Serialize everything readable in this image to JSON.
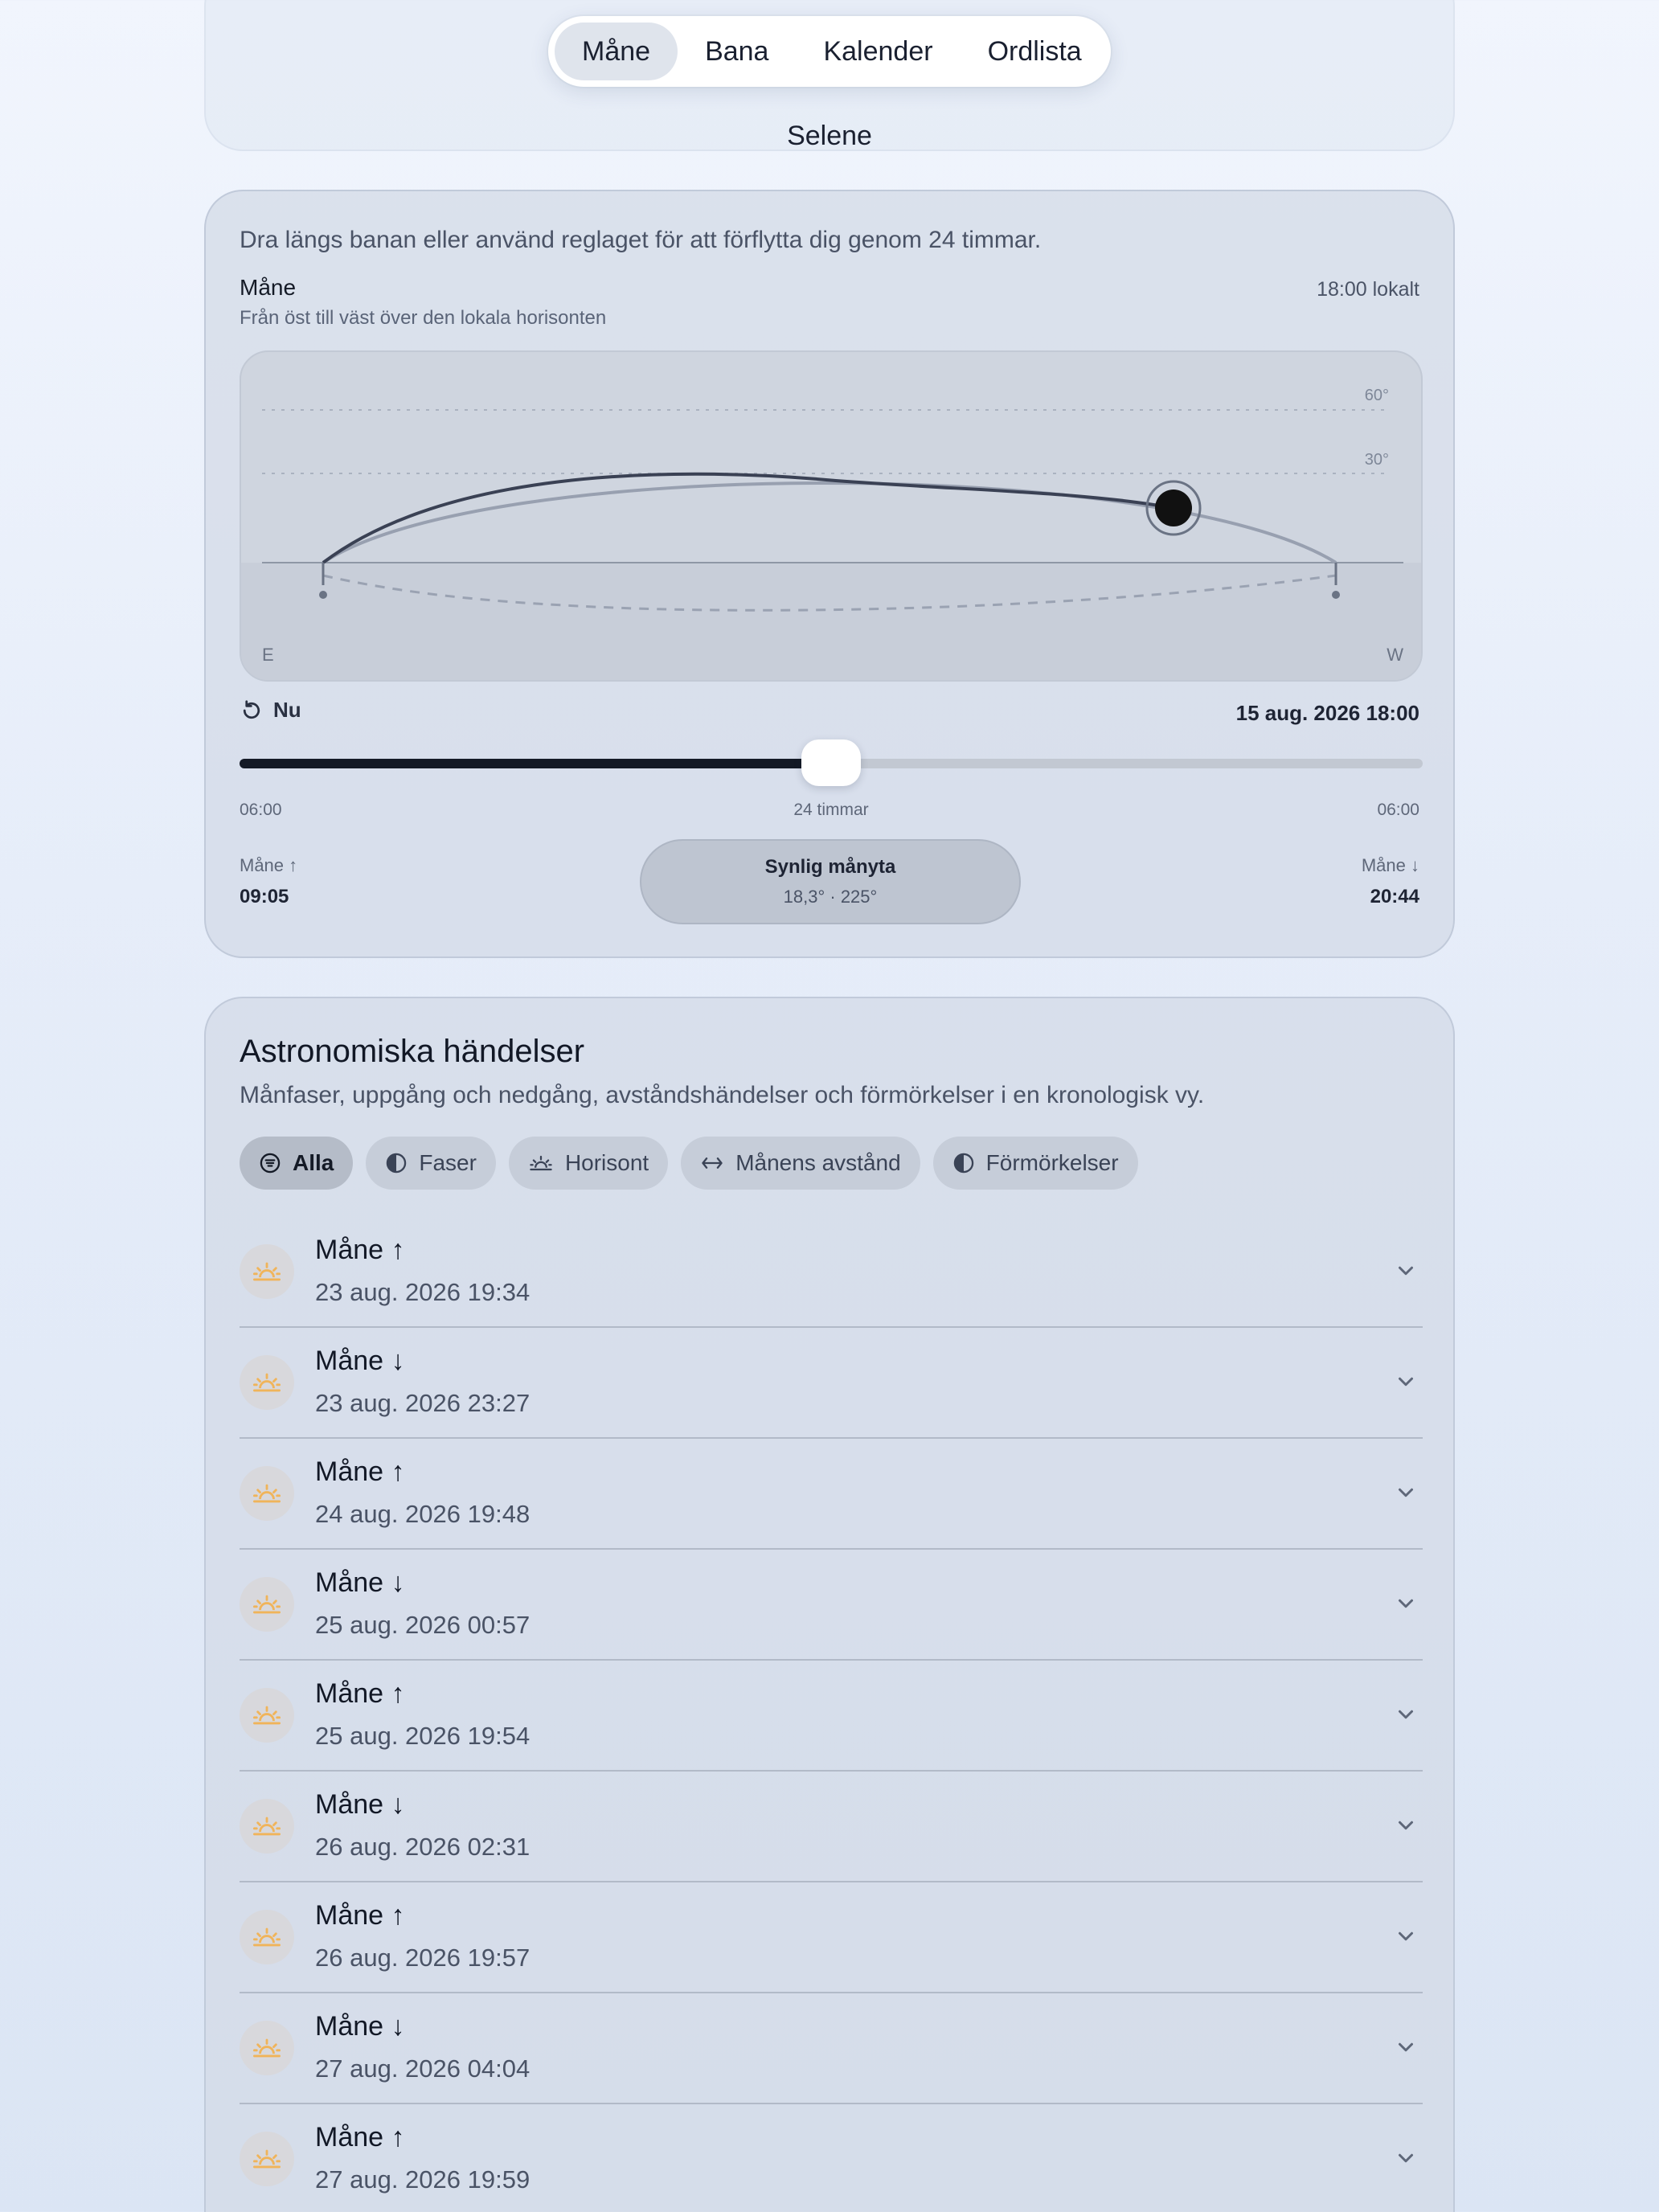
{
  "nav": {
    "tabs": [
      {
        "label": "Måne",
        "active": true
      },
      {
        "label": "Bana",
        "active": false
      },
      {
        "label": "Kalender",
        "active": false
      },
      {
        "label": "Ordlista",
        "active": false
      }
    ]
  },
  "app_title": "Selene",
  "orbit": {
    "hint": "Dra längs banan eller använd reglaget för att förflytta dig genom 24 timmar.",
    "body_name": "Måne",
    "body_subtitle": "Från öst till väst över den lokala horisonten",
    "local_time": "18:00 lokalt",
    "grid_labels": [
      "60°",
      "30°"
    ],
    "direction_left": "E",
    "direction_right": "W",
    "now_label": "Nu",
    "datetime": "15 aug. 2026 18:00",
    "slider_progress": 0.5,
    "slider_ticks": [
      "06:00",
      "24 timmar",
      "06:00"
    ],
    "rise_label": "Måne ↑",
    "rise_time": "09:05",
    "set_label": "Måne ↓",
    "set_time": "20:44",
    "visible_title": "Synlig månyta",
    "visible_values": "18,3° · 225°"
  },
  "events_section": {
    "title": "Astronomiska händelser",
    "subtitle": "Månfaser, uppgång och nedgång, avståndshändelser och förmörkelser i en kronologisk vy.",
    "filters": [
      {
        "label": "Alla",
        "icon": "list-icon",
        "active": true
      },
      {
        "label": "Faser",
        "icon": "half-moon-icon",
        "active": false
      },
      {
        "label": "Horisont",
        "icon": "sunrise-icon",
        "active": false
      },
      {
        "label": "Månens avstånd",
        "icon": "arrows-horizontal-icon",
        "active": false
      },
      {
        "label": "Förmörkelser",
        "icon": "half-moon-icon",
        "active": false
      }
    ],
    "events": [
      {
        "name": "Måne ↑",
        "date": "23 aug. 2026 19:34"
      },
      {
        "name": "Måne ↓",
        "date": "23 aug. 2026 23:27"
      },
      {
        "name": "Måne ↑",
        "date": "24 aug. 2026 19:48"
      },
      {
        "name": "Måne ↓",
        "date": "25 aug. 2026 00:57"
      },
      {
        "name": "Måne ↑",
        "date": "25 aug. 2026 19:54"
      },
      {
        "name": "Måne ↓",
        "date": "26 aug. 2026 02:31"
      },
      {
        "name": "Måne ↑",
        "date": "26 aug. 2026 19:57"
      },
      {
        "name": "Måne ↓",
        "date": "27 aug. 2026 04:04"
      },
      {
        "name": "Måne ↑",
        "date": "27 aug. 2026 19:59"
      }
    ]
  },
  "colors": {
    "accent": "#141a26",
    "icon_warm": "#f0b45a",
    "track": "#c2c8d2"
  }
}
